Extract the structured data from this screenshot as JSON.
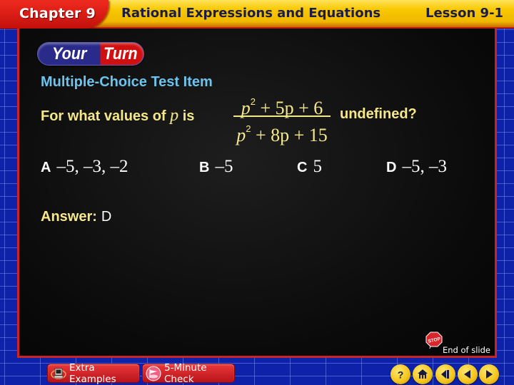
{
  "header": {
    "chapter": "Chapter 9",
    "title": "Rational Expressions and Equations",
    "lesson": "Lesson 9-1"
  },
  "badge": {
    "your": "Your",
    "turn": "Turn"
  },
  "content": {
    "heading": "Multiple-Choice Test Item",
    "question_prefix": "For what values of",
    "question_var": "p",
    "question_is": "is",
    "fraction": {
      "numerator": {
        "var": "p",
        "exp": "2",
        "rest": " + 5p + 6"
      },
      "denominator": {
        "var": "p",
        "exp": "2",
        "rest": " + 8p + 15"
      }
    },
    "question_suffix": "undefined?",
    "choices": [
      {
        "letter": "A",
        "value": "–5, –3, –2"
      },
      {
        "letter": "B",
        "value": "–5"
      },
      {
        "letter": "C",
        "value": "5"
      },
      {
        "letter": "D",
        "value": "–5, –3"
      }
    ],
    "answer_label": "Answer:",
    "answer_value": "D"
  },
  "end_of_slide": {
    "icon": "stop-sign-icon",
    "label": "End of slide"
  },
  "footer": {
    "extra_examples": "Extra Examples",
    "five_minute_check": "5-Minute Check",
    "nav": [
      {
        "name": "help",
        "icon": "question-icon"
      },
      {
        "name": "main-menu",
        "icon": "home-icon"
      },
      {
        "name": "first-slide",
        "icon": "rewind-icon"
      },
      {
        "name": "previous-slide",
        "icon": "left-arrow-icon"
      },
      {
        "name": "next-slide",
        "icon": "right-arrow-icon"
      }
    ]
  },
  "colors": {
    "header_yellow": "#f8c800",
    "chapter_red": "#d01a14",
    "background_blue": "#0d22a8",
    "heading_blue": "#6ec3ec",
    "question_yellow": "#f5e88a",
    "nav_gold": "#f3c31a"
  }
}
